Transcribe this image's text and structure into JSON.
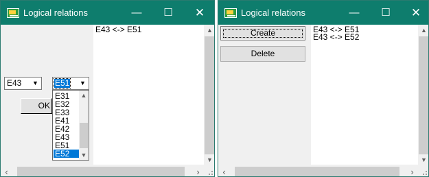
{
  "windows": [
    {
      "title": "Logical relations",
      "list_text": "E43 <-> E51",
      "combo_left": {
        "value": "E43"
      },
      "combo_right": {
        "value": "E51"
      },
      "dropdown_options": [
        "E31",
        "E32",
        "E33",
        "E41",
        "E42",
        "E43",
        "E51",
        "E52"
      ],
      "dropdown_selected": "E52",
      "ok_label": "OK"
    },
    {
      "title": "Logical relations",
      "list_text": "E43 <-> E51\nE43 <-> E52",
      "create_label": "Create",
      "delete_label": "Delete"
    }
  ],
  "titlebar_glyphs": {
    "minimize": "—",
    "maximize": "☐",
    "close": "✕"
  },
  "colors": {
    "titlebar": "#0e7d6d",
    "selection": "#0078d7",
    "window_bg": "#f0f0f0"
  }
}
